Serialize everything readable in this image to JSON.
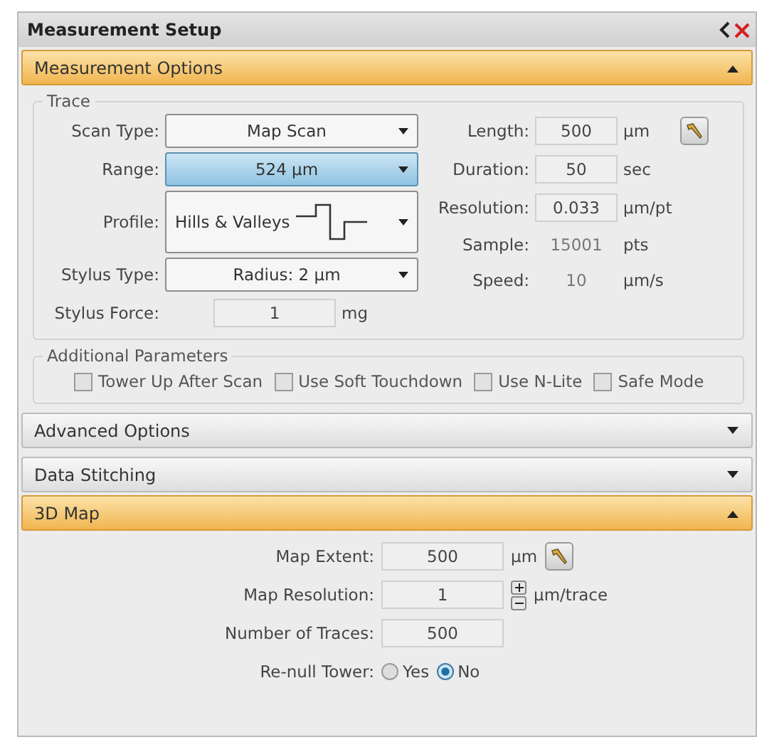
{
  "panel": {
    "title": "Measurement Setup"
  },
  "measurement_options": {
    "title": "Measurement Options",
    "expanded": true,
    "trace": {
      "title": "Trace",
      "left_fields": [
        {
          "label": "Scan Type:",
          "value": "Map Scan",
          "kind": "dropdown",
          "highlighted": false
        },
        {
          "label": "Range:",
          "value": "524 µm",
          "kind": "dropdown",
          "highlighted": true
        },
        {
          "label": "Profile:",
          "value": "Hills & Valleys",
          "kind": "profile",
          "highlighted": false
        },
        {
          "label": "Stylus Type:",
          "value": "Radius: 2 µm",
          "kind": "dropdown",
          "highlighted": false
        },
        {
          "label": "Stylus Force:",
          "value": "1",
          "unit": "mg",
          "kind": "input",
          "highlighted": false
        }
      ],
      "right_fields": [
        {
          "label": "Length:",
          "value": "500",
          "unit": "µm",
          "kind": "input",
          "tool": true
        },
        {
          "label": "Duration:",
          "value": "50",
          "unit": "sec",
          "kind": "input",
          "tool": false
        },
        {
          "label": "Resolution:",
          "value": "0.033",
          "unit": "µm/pt",
          "kind": "input",
          "tool": false
        },
        {
          "label": "Sample:",
          "value": "15001",
          "unit": "pts",
          "kind": "readout",
          "tool": false
        },
        {
          "label": "Speed:",
          "value": "10",
          "unit": "µm/s",
          "kind": "readout",
          "tool": false
        }
      ]
    },
    "additional": {
      "title": "Additional Parameters",
      "checkboxes": [
        {
          "label": "Tower Up After Scan",
          "checked": false
        },
        {
          "label": "Use Soft Touchdown",
          "checked": false
        },
        {
          "label": "Use N-Lite",
          "checked": false
        },
        {
          "label": "Safe Mode",
          "checked": false
        }
      ]
    }
  },
  "collapsed_sections": [
    {
      "title": "Advanced Options",
      "expanded": false
    },
    {
      "title": "Data Stitching",
      "expanded": false
    }
  ],
  "map_3d": {
    "title": "3D Map",
    "expanded": true,
    "fields": [
      {
        "label": "Map Extent:",
        "value": "500",
        "unit": "µm",
        "kind": "tool"
      },
      {
        "label": "Map Resolution:",
        "value": "1",
        "unit": "µm/trace",
        "kind": "spinner"
      },
      {
        "label": "Number of Traces:",
        "value": "500",
        "kind": "plain"
      }
    ],
    "renull": {
      "label": "Re-null Tower:",
      "options": [
        {
          "label": "Yes",
          "selected": false
        },
        {
          "label": "No",
          "selected": true
        }
      ]
    }
  }
}
